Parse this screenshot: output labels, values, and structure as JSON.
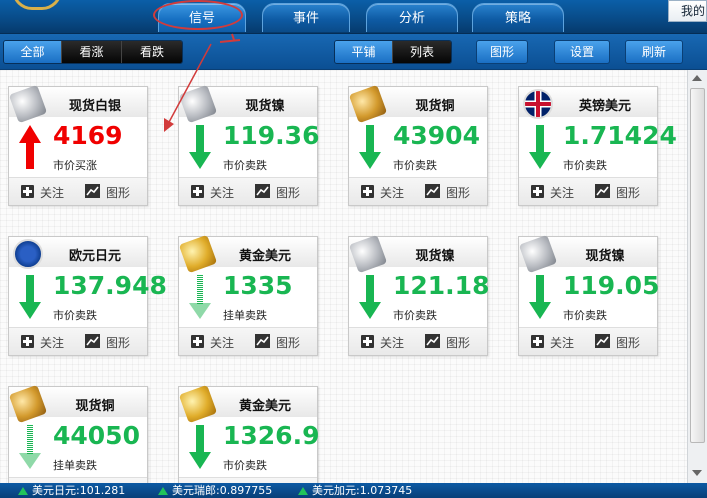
{
  "topbar": {
    "tabs": [
      {
        "label": "信号",
        "active": true
      },
      {
        "label": "事件",
        "active": false
      },
      {
        "label": "分析",
        "active": false
      },
      {
        "label": "策略",
        "active": false
      }
    ],
    "right_label": "我的"
  },
  "toolbar": {
    "filters": [
      {
        "label": "全部",
        "active": true
      },
      {
        "label": "看涨",
        "active": false
      },
      {
        "label": "看跌",
        "active": false
      }
    ],
    "view_modes": [
      {
        "label": "平铺",
        "active": true
      },
      {
        "label": "列表",
        "active": false
      }
    ],
    "chart_button": "图形",
    "settings_button": "设置",
    "refresh_button": "刷新"
  },
  "cards": [
    {
      "name": "现货白银",
      "icon": "silver-bar-icon",
      "value": "4169",
      "direction": "up",
      "signal": "市价买涨"
    },
    {
      "name": "现货镍",
      "icon": "nickel-bar-icon",
      "value": "119.36",
      "direction": "down",
      "signal": "市价卖跌"
    },
    {
      "name": "现货铜",
      "icon": "copper-bar-icon",
      "value": "43904",
      "direction": "down",
      "signal": "市价卖跌"
    },
    {
      "name": "英镑美元",
      "icon": "uk-flag-icon",
      "value": "1.71424",
      "direction": "down",
      "signal": "市价卖跌"
    },
    {
      "name": "欧元日元",
      "icon": "eu-flag-icon",
      "value": "137.948",
      "direction": "down",
      "signal": "市价卖跌"
    },
    {
      "name": "黄金美元",
      "icon": "gold-bar-icon",
      "value": "1335",
      "direction": "down-pending",
      "signal": "挂单卖跌"
    },
    {
      "name": "现货镍",
      "icon": "nickel-bar-icon",
      "value": "121.18",
      "direction": "down",
      "signal": "市价卖跌"
    },
    {
      "name": "现货镍",
      "icon": "nickel-bar-icon",
      "value": "119.05",
      "direction": "down",
      "signal": "市价卖跌"
    },
    {
      "name": "现货铜",
      "icon": "copper-bar-icon",
      "value": "44050",
      "direction": "down-pending",
      "signal": "挂单卖跌"
    },
    {
      "name": "黄金美元",
      "icon": "gold-bar-icon",
      "value": "1326.9",
      "direction": "down",
      "signal": "市价卖跌"
    }
  ],
  "card_actions": {
    "follow_label": "关注",
    "chart_label": "图形"
  },
  "ticker": [
    {
      "text": "美元日元:101.281"
    },
    {
      "text": "美元瑞郎:0.897755"
    },
    {
      "text": "美元加元:1.073745"
    }
  ],
  "colors": {
    "up": "#f00000",
    "down": "#19b652",
    "pending": "#8fd9a8",
    "topbar": "#0b5fa8",
    "annotation": "#d23b3b"
  }
}
